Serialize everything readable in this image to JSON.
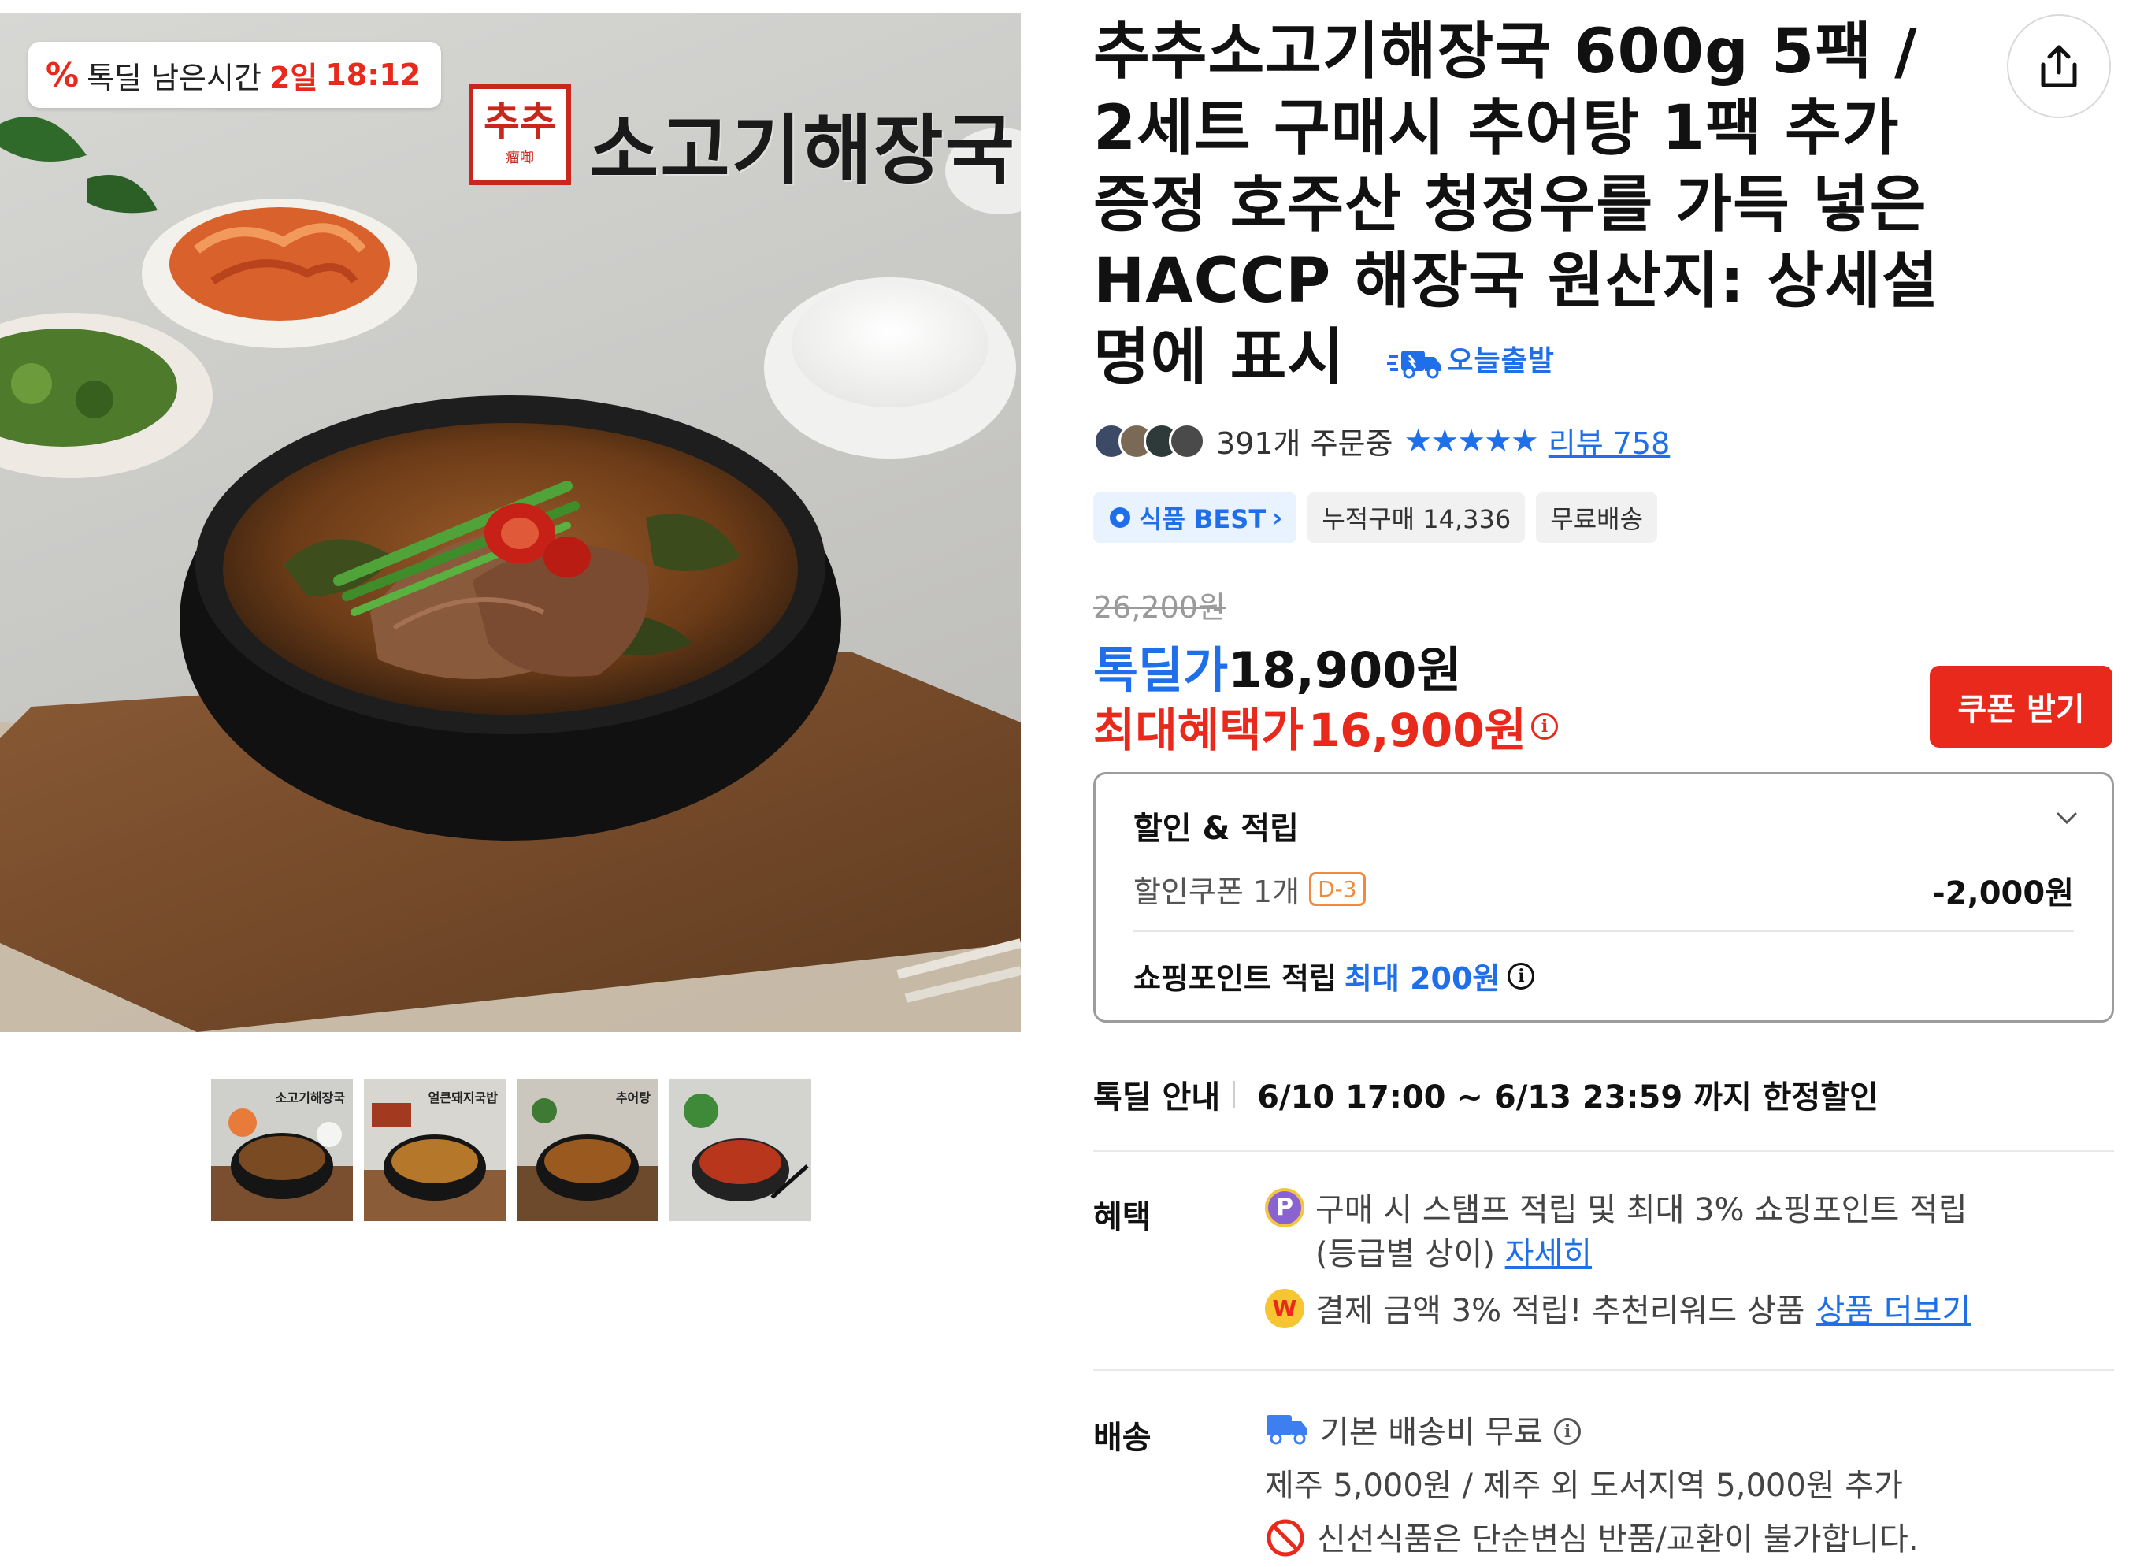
{
  "hero": {
    "timer_label": "톡딜 남은시간",
    "timer_days": "2일",
    "timer_clock": "18:12",
    "brand_logo": "추추",
    "brand_logo_sub": "瘤啣",
    "brand_title": "소고기해장국"
  },
  "thumbnails": [
    {
      "label": "소고기해장국",
      "active": true
    },
    {
      "label": "얼큰돼지국밥",
      "active": false
    },
    {
      "label": "추어탕",
      "active": false
    },
    {
      "label": "",
      "active": false
    }
  ],
  "product": {
    "title": "추추소고기해장국 600g 5팩 / 2세트 구매시 추어탕 1팩 추가증정 호주산 청정우를 가득 넣은 HACCP 해장국 원산지: 상세설명에 표시",
    "today_badge": "오늘출발",
    "order_count": "391개 주문중",
    "stars": "★★★★★",
    "review_link": "리뷰 758",
    "chips": [
      "식품 BEST",
      "누적구매 14,336",
      "무료배송"
    ],
    "original_price": "26,200원",
    "deal_label": "톡딜가",
    "deal_price": "18,900원",
    "max_label": "최대혜택가",
    "max_price": "16,900원",
    "coupon_button": "쿠폰 받기"
  },
  "benefit_box": {
    "title": "할인 & 적립",
    "coupon_label": "할인쿠폰 1개",
    "coupon_dday": "D-3",
    "coupon_amount": "-2,000원",
    "point_label": "쇼핑포인트 적립",
    "point_value": "최대 200원"
  },
  "talkdeal_info": {
    "label": "톡딜 안내",
    "text": "6/10 17:00 ~ 6/13 23:59 까지 한정할인"
  },
  "benefits": {
    "label": "혜택",
    "line1": "구매 시 스탬프 적립 및 최대 3% 쇼핑포인트 적립",
    "line1b": "(등급별 상이)",
    "line1_link": "자세히",
    "line2": "결제 금액 3% 적립! 추천리워드 상품",
    "line2_link": "상품 더보기"
  },
  "shipping": {
    "label": "배송",
    "line1": "기본 배송비 무료",
    "line2": "제주 5,000원 / 제주 외 도서지역 5,000원 추가",
    "line3": "신선식품은 단순변심 반품/교환이 불가합니다."
  },
  "colors": {
    "accent_blue": "#1f6feb",
    "accent_red": "#e8291b"
  },
  "icons": [
    "percent-icon",
    "share-icon",
    "truck-icon",
    "chevron-down-icon",
    "info-icon",
    "point-icon",
    "coin-icon",
    "delivery-icon",
    "prohibited-icon"
  ]
}
